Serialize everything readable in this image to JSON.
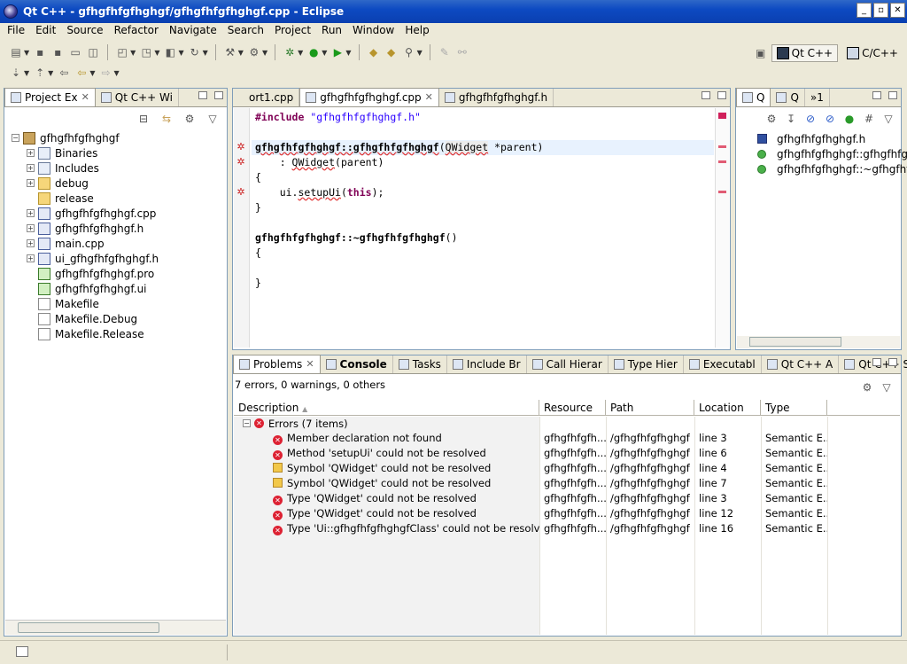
{
  "window": {
    "title": "Qt C++ - gfhgfhfgfhghgf/gfhgfhfgfhghgf.cpp - Eclipse"
  },
  "menu": [
    "File",
    "Edit",
    "Source",
    "Refactor",
    "Navigate",
    "Search",
    "Project",
    "Run",
    "Window",
    "Help"
  ],
  "perspectives": [
    {
      "label": "Qt C++",
      "active": true
    },
    {
      "label": "C/C++",
      "active": false
    }
  ],
  "project_explorer": {
    "tabs": [
      "Project Ex",
      "Qt C++ Wi"
    ],
    "tree": [
      {
        "label": "gfhgfhfgfhghgf",
        "icon": "project-icon",
        "expander": "minus",
        "level": 0
      },
      {
        "label": "Binaries",
        "icon": "binaries-icon",
        "expander": "plus",
        "level": 1
      },
      {
        "label": "Includes",
        "icon": "includes-icon",
        "expander": "plus",
        "level": 1
      },
      {
        "label": "debug",
        "icon": "folder-icon",
        "expander": "plus",
        "level": 1
      },
      {
        "label": "release",
        "icon": "folder-icon",
        "expander": "none",
        "level": 1
      },
      {
        "label": "gfhgfhfgfhghgf.cpp",
        "icon": "cpp-file-icon",
        "expander": "plus",
        "level": 1
      },
      {
        "label": "gfhgfhfgfhghgf.h",
        "icon": "header-file-icon",
        "expander": "plus",
        "level": 1
      },
      {
        "label": "main.cpp",
        "icon": "cpp-file-icon",
        "expander": "plus",
        "level": 1
      },
      {
        "label": "ui_gfhgfhfgfhghgf.h",
        "icon": "header-file-icon",
        "expander": "plus",
        "level": 1
      },
      {
        "label": "gfhgfhfgfhghgf.pro",
        "icon": "pro-file-icon",
        "expander": "none",
        "level": 1
      },
      {
        "label": "gfhgfhfgfhghgf.ui",
        "icon": "ui-file-icon",
        "expander": "none",
        "level": 1
      },
      {
        "label": "Makefile",
        "icon": "makefile-icon",
        "expander": "none",
        "level": 1
      },
      {
        "label": "Makefile.Debug",
        "icon": "file-icon",
        "expander": "none",
        "level": 1
      },
      {
        "label": "Makefile.Release",
        "icon": "file-icon",
        "expander": "none",
        "level": 1
      }
    ]
  },
  "editor": {
    "tabs": [
      "ort1.cpp",
      "gfhgfhfgfhghgf.cpp",
      "gfhgfhfgfhghgf.h"
    ],
    "lines": {
      "l1_kw": "#include",
      "l1_str": "\"gfhgfhfgfhghgf.h\"",
      "l3_fn": "gfhgfhfgfhghgf::gfhgfhfgfhghgf",
      "l3_open": "(",
      "l3_type": "QWidget",
      "l3_rest": " *parent)",
      "l4_pre": "    : ",
      "l4_type": "QWidget",
      "l4_rest": "(parent)",
      "l5": "{",
      "l6_pre": "    ui.",
      "l6_fn": "setupUi",
      "l6_open": "(",
      "l6_kw": "this",
      "l6_rest": ");",
      "l7": "}",
      "l9_fn": "gfhgfhfgfhghgf::~gfhgfhfgfhghgf",
      "l9_rest": "()",
      "l10": "{",
      "l12": "}"
    }
  },
  "outline": {
    "tabs": [
      "Q",
      "Q",
      "»1"
    ],
    "items": [
      {
        "label": "gfhgfhfgfhghgf.h",
        "icon": "include-icon"
      },
      {
        "label": "gfhgfhfgfhghgf::gfhgfhfgfhghgf",
        "icon": "method-error-icon"
      },
      {
        "label": "gfhgfhfgfhghgf::~gfhgfhfgfhghgf",
        "icon": "method-icon"
      }
    ]
  },
  "problems": {
    "tabs": [
      "Problems",
      "Console",
      "Tasks",
      "Include Br",
      "Call Hierar",
      "Type Hier",
      "Executabl",
      "Qt C++ A",
      "Qt C++ Si"
    ],
    "summary": "7 errors, 0 warnings, 0 others",
    "columns": [
      "Description",
      "Resource",
      "Path",
      "Location",
      "Type"
    ],
    "group": "Errors (7 items)",
    "rows": [
      {
        "desc": "Member declaration not found",
        "res": "gfhgfhfgfh...",
        "path": "/gfhgfhfgfhghgf",
        "loc": "line 3",
        "type": "Semantic E...",
        "icon": "error"
      },
      {
        "desc": "Method 'setupUi' could not be resolved",
        "res": "gfhgfhfgfh...",
        "path": "/gfhgfhfgfhghgf",
        "loc": "line 6",
        "type": "Semantic E...",
        "icon": "error"
      },
      {
        "desc": "Symbol 'QWidget' could not be resolved",
        "res": "gfhgfhfgfh...",
        "path": "/gfhgfhfgfhghgf",
        "loc": "line 4",
        "type": "Semantic E...",
        "icon": "symbol"
      },
      {
        "desc": "Symbol 'QWidget' could not be resolved",
        "res": "gfhgfhfgfh...",
        "path": "/gfhgfhfgfhghgf",
        "loc": "line 7",
        "type": "Semantic E...",
        "icon": "symbol"
      },
      {
        "desc": "Type 'QWidget' could not be resolved",
        "res": "gfhgfhfgfh...",
        "path": "/gfhgfhfgfhghgf",
        "loc": "line 3",
        "type": "Semantic E...",
        "icon": "error"
      },
      {
        "desc": "Type 'QWidget' could not be resolved",
        "res": "gfhgfhfgfh...",
        "path": "/gfhgfhfgfhghgf",
        "loc": "line 12",
        "type": "Semantic E...",
        "icon": "error"
      },
      {
        "desc": "Type 'Ui::gfhgfhfgfhghgfClass' could not be resolved",
        "res": "gfhgfhfgfh...",
        "path": "/gfhgfhfgfhghgf",
        "loc": "line 16",
        "type": "Semantic E...",
        "icon": "error"
      }
    ]
  },
  "colors": {
    "titlebar": "#0d4ac2",
    "error": "#dd2233",
    "keyword": "#7f0055",
    "string": "#2a00ff"
  }
}
